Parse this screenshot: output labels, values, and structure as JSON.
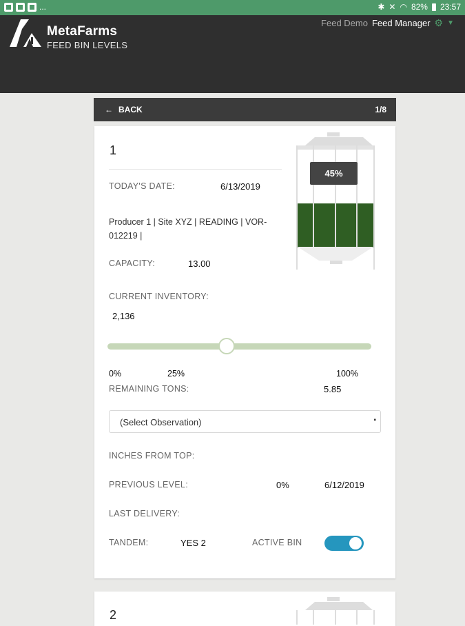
{
  "status_bar": {
    "left_text": "...",
    "battery": "82%",
    "time": "23:57"
  },
  "header": {
    "brand": "MetaFarms",
    "subtitle": "FEED BIN LEVELS",
    "org": "Feed Demo",
    "role": "Feed Manager"
  },
  "nav": {
    "back_label": "BACK",
    "pager": "1/8"
  },
  "bin": {
    "number": "1",
    "fill_percent": 45,
    "fill_label": "45%",
    "todays_date_label": "TODAY'S DATE:",
    "todays_date": "6/13/2019",
    "description": "Producer 1 | Site XYZ | READING | VOR-012219 |",
    "capacity_label": "CAPACITY:",
    "capacity": "13.00",
    "inventory_label": "CURRENT INVENTORY:",
    "inventory": "2,136",
    "slider_value_percent": 45,
    "slider_ticks": [
      "0%",
      "25%",
      "100%"
    ],
    "remaining_label": "REMAINING TONS:",
    "remaining": "5.85",
    "observation_select": {
      "selected": "(Select Observation)"
    },
    "inches_label": "INCHES FROM TOP:",
    "previous_label": "PREVIOUS LEVEL:",
    "previous_percent": "0%",
    "previous_date": "6/12/2019",
    "last_delivery_label": "LAST DELIVERY:",
    "tandem_label": "TANDEM:",
    "tandem_value": "YES 2",
    "active_bin_label": "ACTIVE BIN",
    "active_bin": true
  },
  "next_bin": {
    "number": "2"
  },
  "colors": {
    "status_bar": "#4e9a6a",
    "header_bg": "#2f2f2f",
    "feed_fill": "#2f5e23",
    "slider_track": "#c6d7b8",
    "toggle_on": "#2596be"
  }
}
